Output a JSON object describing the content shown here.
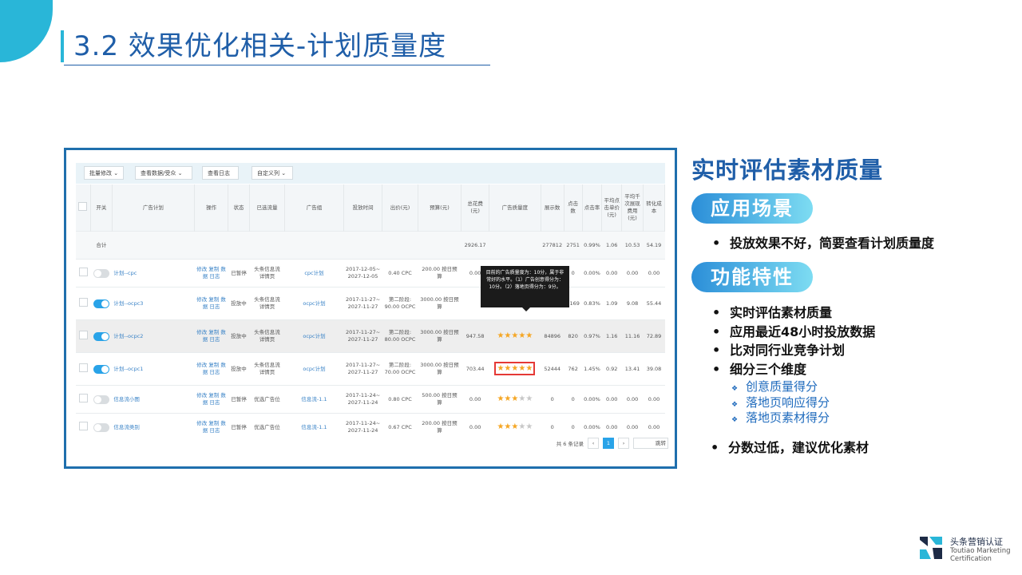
{
  "slide": {
    "title": "3.2 效果优化相关-计划质量度"
  },
  "screenshot": {
    "toolbar": [
      "批量修改",
      "查看数据/受众",
      "查看日志",
      "自定义列"
    ],
    "headers": [
      "开关",
      "广告计划",
      "操作",
      "状态",
      "已选流量",
      "广告组",
      "投放时间",
      "出价(元)",
      "预算(元)",
      "总花费(元)",
      "广告质量度",
      "展示数",
      "点击数",
      "点击率",
      "平均点击单价(元)",
      "平均千次展现费用(元)",
      "转化成本"
    ],
    "total": {
      "label": "合计",
      "cost": "2926.17",
      "impressions": "277812",
      "clicks": "2751",
      "ctr": "0.99%",
      "cpc": "1.06",
      "cpm": "10.53",
      "cpa": "54.19"
    },
    "rows": [
      {
        "toggle": false,
        "name": "计划--cpc",
        "ops": "修改 复制 数据 日志",
        "status": "已暂停",
        "traffic": "头条信息流 详情页",
        "group": "cpc计划",
        "time": "2017-12-05~ 2027-12-05",
        "bid": "0.40 CPC",
        "budget": "200.00 按日预算",
        "cost": "0.00",
        "quality": "-",
        "impressions": "0",
        "clicks": "0",
        "ctr": "0.00%",
        "cpc": "0.00",
        "cpm": "0.00",
        "cpa": "0.00"
      },
      {
        "toggle": true,
        "name": "计划--ocpc3",
        "ops": "修改 复制 数据 日志",
        "status": "投放中",
        "traffic": "头条信息流 详情页",
        "group": "ocpc计划",
        "time": "2017-11-27~ 2027-11-27",
        "bid": "第二阶段: 90.00 OCPC",
        "budget": "3000.00 按日预算",
        "cost": "",
        "quality": "",
        "impressions": "",
        "clicks": "1169",
        "ctr": "0.83%",
        "cpc": "1.09",
        "cpm": "9.08",
        "cpa": "55.44"
      },
      {
        "toggle": true,
        "name": "计划--ocpc2",
        "ops": "修改 复制 数据 日志",
        "status": "投放中",
        "traffic": "头条信息流 详情页",
        "group": "ocpc计划",
        "time": "2017-11-27~ 2027-11-27",
        "bid": "第二阶段: 80.00 OCPC",
        "budget": "3000.00 按日预算",
        "cost": "947.58",
        "quality": 5,
        "impressions": "84896",
        "clicks": "820",
        "ctr": "0.97%",
        "cpc": "1.16",
        "cpm": "11.16",
        "cpa": "72.89"
      },
      {
        "toggle": true,
        "name": "计划--ocpc1",
        "ops": "修改 复制 数据 日志",
        "status": "投放中",
        "traffic": "头条信息流 详情页",
        "group": "ocpc计划",
        "time": "2017-11-27~ 2027-11-27",
        "bid": "第二阶段: 70.00 OCPC",
        "budget": "3000.00 按日预算",
        "cost": "703.44",
        "quality": 5,
        "impressions": "52444",
        "clicks": "762",
        "ctr": "1.45%",
        "cpc": "0.92",
        "cpm": "13.41",
        "cpa": "39.08"
      },
      {
        "toggle": false,
        "name": "信息流小图",
        "ops": "修改 复制 数据 日志",
        "status": "已暂停",
        "traffic": "优选广告位",
        "group": "信息流-1.1",
        "time": "2017-11-24~ 2027-11-24",
        "bid": "0.80 CPC",
        "budget": "500.00 按日预算",
        "cost": "0.00",
        "quality": 3,
        "impressions": "0",
        "clicks": "0",
        "ctr": "0.00%",
        "cpc": "0.00",
        "cpm": "0.00",
        "cpa": "0.00"
      },
      {
        "toggle": false,
        "name": "信息流类别",
        "ops": "修改 复制 数据 日志",
        "status": "已暂停",
        "traffic": "优选广告位",
        "group": "信息流-1.1",
        "time": "2017-11-24~ 2027-11-24",
        "bid": "0.67 CPC",
        "budget": "200.00 按日预算",
        "cost": "0.00",
        "quality": 2.5,
        "impressions": "0",
        "clicks": "0",
        "ctr": "0.00%",
        "cpc": "0.00",
        "cpm": "0.00",
        "cpa": "0.00"
      }
    ],
    "tooltip": "目前的广告质量度为：10分，属于非常好的水平。（1）广告创意得分为：10分。（2）落地页得分为：9分。",
    "pager": {
      "total": "共 6 条记录",
      "prev": "‹",
      "page": "1",
      "next": "›",
      "jump": "跳转"
    }
  },
  "panel": {
    "title": "实时评估素材质量",
    "section1": "应用场景",
    "scene": "投放效果不好，简要查看计划质量度",
    "section2": "功能特性",
    "features": [
      "实时评估素材质量",
      "应用最近48小时投放数据",
      "比对同行业竞争计划",
      "细分三个维度"
    ],
    "dimensions": [
      "创意质量得分",
      "落地页响应得分",
      "落地页素材得分"
    ],
    "advice": "分数过低，建议优化素材"
  },
  "logo": {
    "cn": "头条营销认证",
    "en1": "Toutiao Marketing",
    "en2": "Certification"
  }
}
